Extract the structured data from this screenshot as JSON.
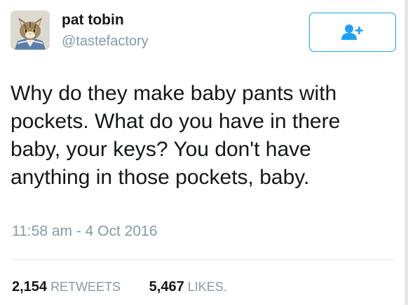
{
  "user": {
    "display_name": "pat tobin",
    "handle": "@tastefactory",
    "avatar_icon": "cat-avatar-icon"
  },
  "follow_button": {
    "icon": "add-user-icon",
    "color": "#1da1f2"
  },
  "tweet": {
    "text": "Why do they make baby pants with\npockets. What do you have in there\nbaby, your keys? You don't have\nanything in those pockets, baby.",
    "timestamp": "11:58 am - 4 Oct 2016"
  },
  "stats": {
    "retweets_count": "2,154",
    "retweets_label": "RETWEETS",
    "likes_count": "5,467",
    "likes_label": "LIKES."
  },
  "colors": {
    "text_primary": "#14171a",
    "text_secondary": "#8899a6",
    "accent": "#1da1f2",
    "divider": "#e1e8ed"
  }
}
